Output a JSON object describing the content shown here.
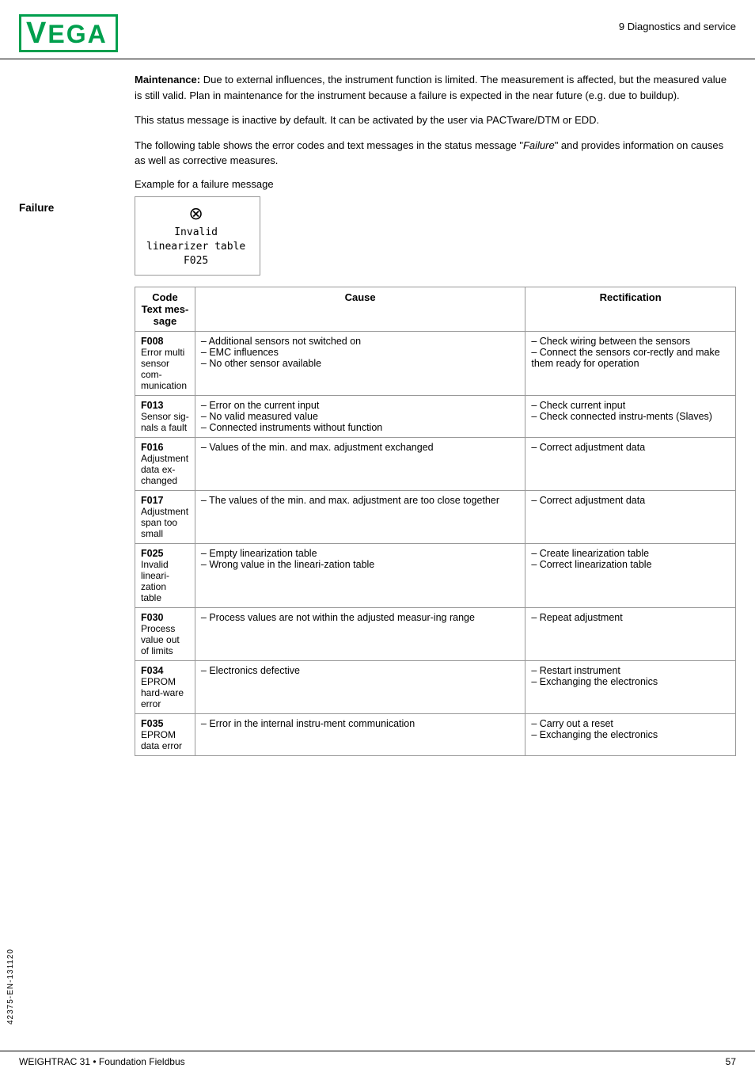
{
  "header": {
    "logo": "VEGA",
    "section": "9 Diagnostics and service"
  },
  "maintenance_para1": "Maintenance: Due to external influences, the instrument function is limited. The measurement is affected, but the measured value is still valid. Plan in maintenance for the instrument  because a failure is expected in the near future (e.g. due to buildup).",
  "maintenance_para2": "This status message is inactive by default. It can be activated by the user via PACTware/DTM or EDD.",
  "failure_label": "Failure",
  "failure_intro": "The following table shows the error codes and text messages in the status message \"Failure\" and provides information on causes as well as corrective measures.",
  "example_label": "Example for a failure message",
  "example_icon": "⊗",
  "example_text": "Invalid\nlinearizer table\nF025",
  "table_headers": {
    "code": "Code",
    "text_message": "Text mes-\nsage",
    "cause": "Cause",
    "rectification": "Rectification"
  },
  "table_rows": [
    {
      "code": "F008",
      "text_msg": "Error multi sensor com-munication",
      "causes": [
        "Additional sensors not switched on",
        "EMC influences",
        "No other sensor available"
      ],
      "rectifications": [
        "Check wiring between the sensors",
        "Connect the sensors cor-rectly and make them ready for operation"
      ]
    },
    {
      "code": "F013",
      "text_msg": "Sensor sig-nals a fault",
      "causes": [
        "Error on the current input",
        "No valid measured value",
        "Connected instruments without function"
      ],
      "rectifications": [
        "Check current input",
        "Check connected instru-ments (Slaves)"
      ]
    },
    {
      "code": "F016",
      "text_msg": "Adjustment data ex-changed",
      "causes": [
        "Values of the min. and max. adjustment exchanged"
      ],
      "rectifications": [
        "Correct adjustment data"
      ]
    },
    {
      "code": "F017",
      "text_msg": "Adjustment span too small",
      "causes": [
        "The values of the min. and max. adjustment are too close together"
      ],
      "rectifications": [
        "Correct adjustment data"
      ]
    },
    {
      "code": "F025",
      "text_msg": "Invalid lineari-zation table",
      "causes": [
        "Empty linearization table",
        "Wrong value in the lineari-zation table"
      ],
      "rectifications": [
        "Create linearization table",
        "Correct linearization table"
      ]
    },
    {
      "code": "F030",
      "text_msg": "Process value out of limits",
      "causes": [
        "Process values are not within the adjusted measur-ing range"
      ],
      "rectifications": [
        "Repeat adjustment"
      ]
    },
    {
      "code": "F034",
      "text_msg": "EPROM hard-ware error",
      "causes": [
        "Electronics defective"
      ],
      "rectifications": [
        "Restart instrument",
        "Exchanging the electronics"
      ]
    },
    {
      "code": "F035",
      "text_msg": "EPROM data error",
      "causes": [
        "Error in the internal instru-ment communication"
      ],
      "rectifications": [
        "Carry out a reset",
        "Exchanging the electronics"
      ]
    }
  ],
  "footer": {
    "left": "WEIGHTRAC 31 • Foundation Fieldbus",
    "right": "57",
    "vertical": "42375-EN-131120"
  }
}
